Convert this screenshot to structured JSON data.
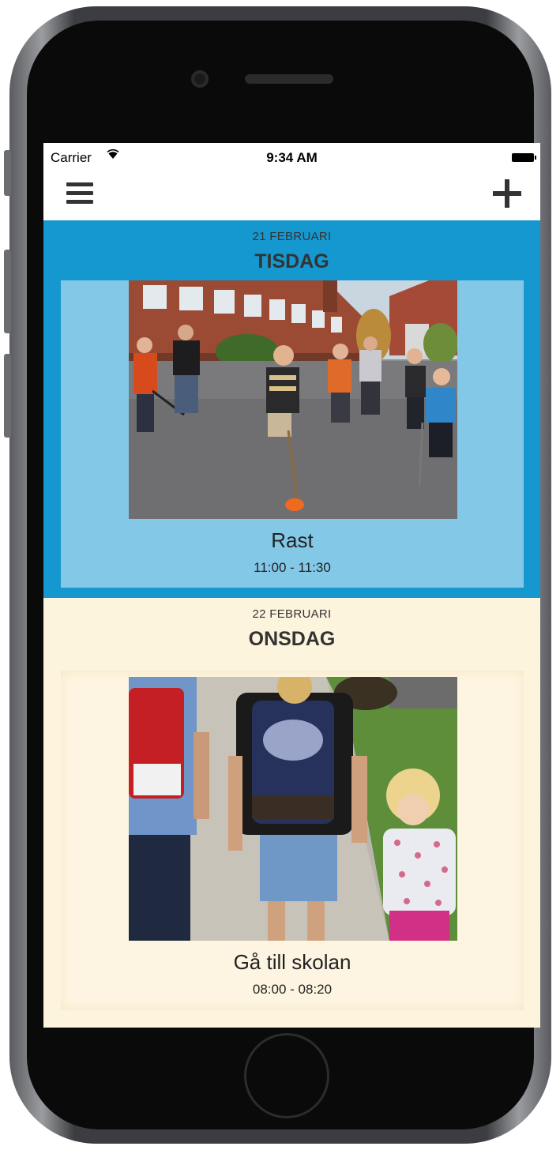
{
  "status_bar": {
    "carrier": "Carrier",
    "time": "9:34 AM"
  },
  "nav": {
    "menu_icon": "hamburger-menu-icon",
    "add_icon": "plus-icon"
  },
  "days": [
    {
      "date": "21 FEBRUARI",
      "weekday": "TISDAG",
      "background": "#1598cf",
      "card_background": "#84c8e8",
      "activity": {
        "title": "Rast",
        "time": "11:00 - 11:30",
        "image": "children-playing-floorball-photo"
      }
    },
    {
      "date": "22 FEBRUARI",
      "weekday": "ONSDAG",
      "background": "#fdf4de",
      "card_background": "#fdf5e1",
      "activity": {
        "title": "Gå till skolan",
        "time": "08:00 - 08:20",
        "image": "children-walking-to-school-photo"
      }
    }
  ]
}
